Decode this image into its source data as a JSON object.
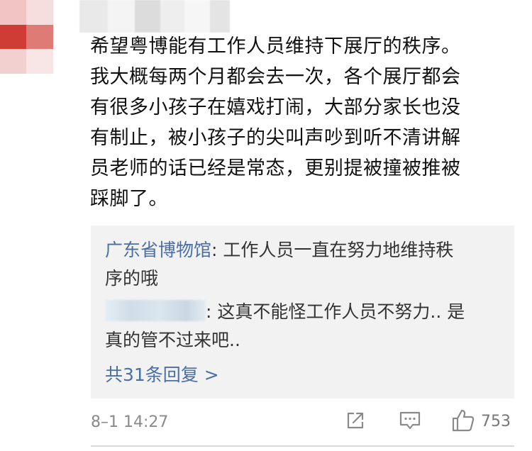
{
  "comment": {
    "avatar_icon": "pixelated-avatar-icon",
    "avatar_colors": [
      "#f2c4c4",
      "#f6dede",
      "#ffffff",
      "#cf3b35",
      "#df7b75",
      "#ffffff",
      "#f2d0d0",
      "#f8e6e6",
      "#ffffff"
    ],
    "username_blur_colors": [
      "#e9e9e9",
      "#f4f4f4",
      "#dcdcdc",
      "#eeeeee",
      "#f6f6f6",
      "#e4e4e4"
    ],
    "text_lines": [
      "希望粤博能有工作人员维持下展厅的秩序。",
      "我大概每两个月都会去一次，各个展厅都会",
      "有很多小孩子在嬉戏打闹，大部分家长也没",
      "有制止，被小孩子的尖叫声吵到听不清讲解",
      "员老师的话已经是常态，更别提被撞被推被",
      "踩脚了。"
    ],
    "timestamp": "8–1 14:27"
  },
  "replies": {
    "reply1": {
      "author": "广东省博物馆",
      "text_line1": ": 工作人员一直在努力地维持秩",
      "text_line2": "序的哦"
    },
    "reply2": {
      "text_line1": ": 这真不能怪工作人员不努力.. 是",
      "text_line2": "真的管不过来吧.."
    },
    "more_label": "共31条回复 >"
  },
  "actions": {
    "share_icon": "share-icon",
    "comment_icon": "comment-icon",
    "like_icon": "thumbs-up-icon",
    "like_count": "753"
  },
  "colors": {
    "link": "#4a6fa5",
    "reply_bg": "#f2f2f2",
    "meta": "#8a8a8a"
  }
}
